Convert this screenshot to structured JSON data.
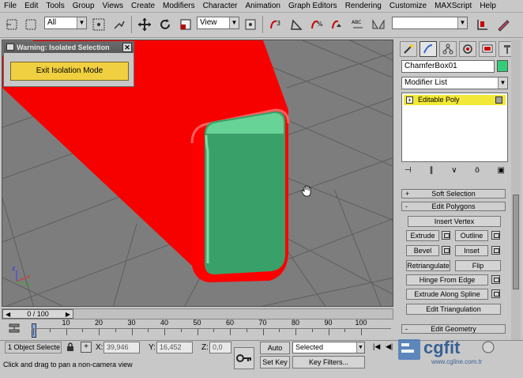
{
  "menu": [
    "File",
    "Edit",
    "Tools",
    "Group",
    "Views",
    "Create",
    "Modifiers",
    "Character",
    "Animation",
    "Graph Editors",
    "Rendering",
    "Customize",
    "MAXScript",
    "Help"
  ],
  "toolbar": {
    "selection_filter": "All",
    "reference_coord": "View"
  },
  "warning": {
    "title": "Warning: Isolated Selection",
    "close": "✕",
    "exit_button": "Exit Isolation Mode"
  },
  "panel": {
    "object_name": "ChamferBox01",
    "object_color": "#33cc77",
    "modifier_list": "Modifier List",
    "stack_item": "Editable Poly",
    "rollouts": {
      "soft_selection": "Soft Selection",
      "edit_polygons": "Edit Polygons",
      "edit_geometry": "Edit Geometry"
    },
    "buttons": {
      "insert_vertex": "Insert Vertex",
      "extrude": "Extrude",
      "outline": "Outline",
      "bevel": "Bevel",
      "inset": "Inset",
      "retriangulate": "Retriangulate",
      "flip": "Flip",
      "hinge_from_edge": "Hinge From Edge",
      "extrude_along_spline": "Extrude Along Spline",
      "edit_triangulation": "Edit Triangulation"
    }
  },
  "timeline": {
    "frame": "0 / 100",
    "ticks": [
      "10",
      "20",
      "30",
      "40",
      "50",
      "60",
      "70",
      "80",
      "90",
      "100"
    ]
  },
  "status": {
    "selection_count": "1 Object Selecte",
    "x_label": "X:",
    "x_value": "39,946",
    "y_label": "Y:",
    "y_value": "16,452",
    "z_label": "Z:",
    "z_value": "0,0",
    "auto_key": "Auto Key",
    "set_key": "Set Key",
    "key_mode": "Selected",
    "key_filters": "Key Filters...",
    "prompt": "Click and drag to pan a non-camera view"
  },
  "watermark": {
    "brand": "cgfit",
    "url": "www.cgline.com.tr"
  },
  "colors": {
    "box_red": "#ff0000",
    "face_green": "#3aa06a",
    "selection_yellow": "#f2e838",
    "exit_button_yellow": "#f0d040"
  }
}
